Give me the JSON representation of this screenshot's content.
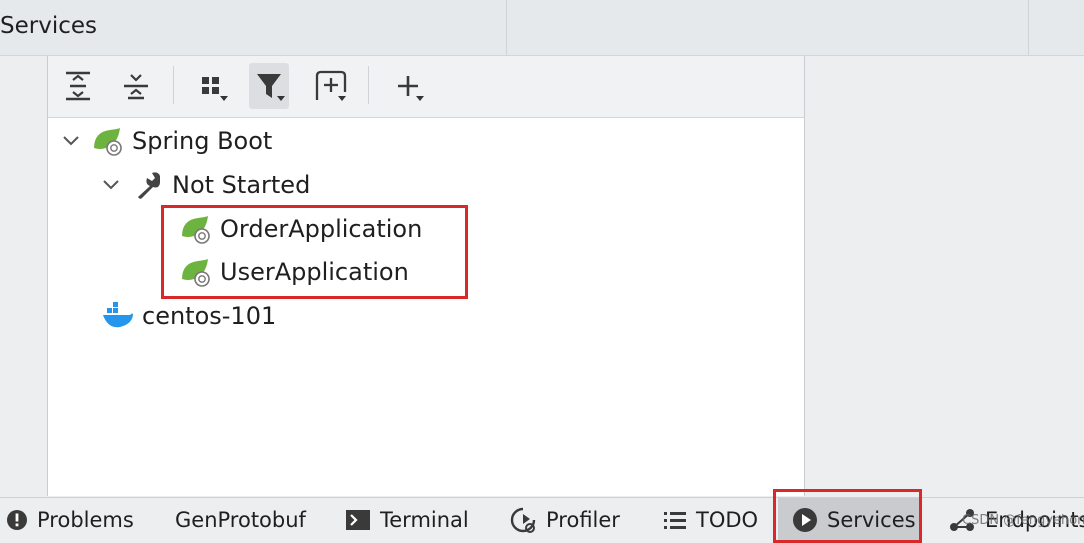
{
  "header": {
    "title": "Services"
  },
  "toolbar": {
    "buttons": [
      {
        "icon": "expand-all-icon"
      },
      {
        "icon": "collapse-all-icon"
      },
      {
        "icon": "group-by-icon"
      },
      {
        "icon": "filter-icon",
        "active": true
      },
      {
        "icon": "new-tab-icon"
      },
      {
        "icon": "add-service-icon"
      }
    ]
  },
  "tree": {
    "spring_boot": "Spring Boot",
    "not_started": "Not Started",
    "apps": [
      "OrderApplication",
      "UserApplication"
    ],
    "docker": "centos-101"
  },
  "bottom_tabs": [
    {
      "label": "Problems",
      "icon": "problems-icon"
    },
    {
      "label": "GenProtobuf",
      "icon": ""
    },
    {
      "label": "Terminal",
      "icon": "terminal-icon"
    },
    {
      "label": "Profiler",
      "icon": "profiler-icon"
    },
    {
      "label": "TODO",
      "icon": "todo-icon"
    },
    {
      "label": "Services",
      "icon": "services-icon",
      "active": true
    },
    {
      "label": "Endpoints",
      "icon": "endpoints-icon"
    }
  ],
  "watermark": "CSDN @fengyehongWorld",
  "colors": {
    "highlight": "#d9282a",
    "spring_green": "#6db33f",
    "docker_blue": "#2496ed"
  }
}
